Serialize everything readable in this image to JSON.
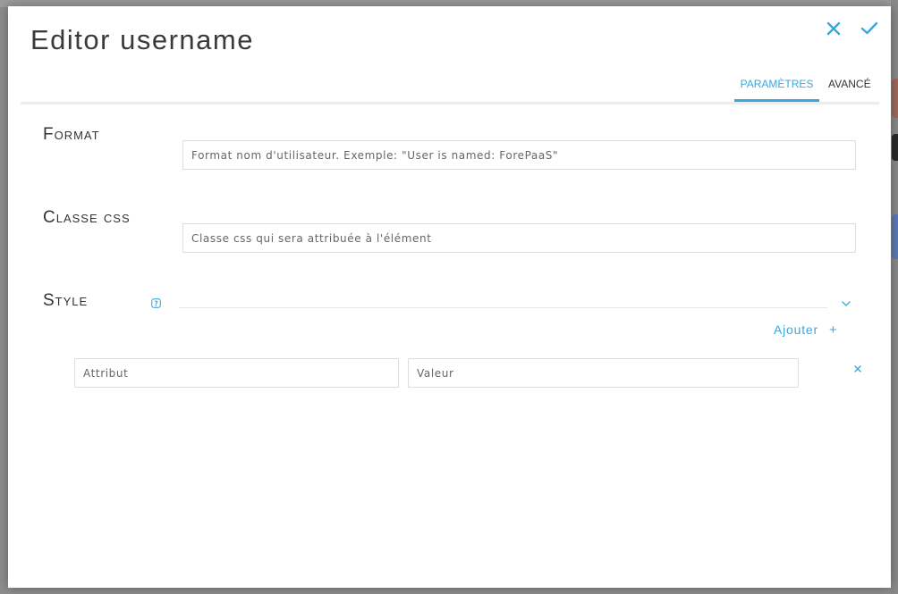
{
  "modal": {
    "title": "Editor username",
    "close_icon": "close-icon",
    "confirm_icon": "check-icon"
  },
  "tabs": [
    {
      "label": "Paramètres",
      "active": true
    },
    {
      "label": "Avancé",
      "active": false
    }
  ],
  "fields": {
    "format": {
      "label": "Format",
      "placeholder": "Format nom d'utilisateur. Exemple: \"User is named: ForePaaS\"",
      "value": ""
    },
    "css_class": {
      "label": "Classe css",
      "placeholder": "Classe css qui sera attribuée à l'élément",
      "value": ""
    },
    "style": {
      "label": "Style",
      "help_icon": "question-icon",
      "dropdown_icon": "chevron-down-icon",
      "add_label": "Ajouter",
      "add_icon": "+",
      "rows": [
        {
          "attribute_placeholder": "Attribut",
          "value_placeholder": "Valeur",
          "remove_icon": "close-icon"
        }
      ]
    }
  },
  "colors": {
    "accent": "#3aa7de",
    "text": "#333333",
    "border": "#dddddd"
  }
}
